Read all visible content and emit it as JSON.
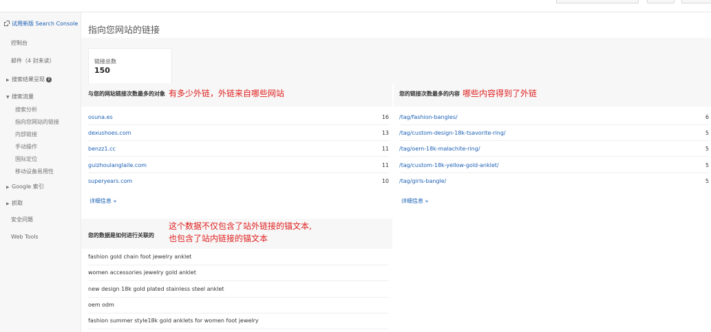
{
  "sidebar": {
    "try_console": "试用新版 Search Console",
    "dashboard": "控制台",
    "messages": "邮件（4 封未读）",
    "search_appearance": "搜索结果呈现",
    "search_traffic": "搜索流量",
    "sub": [
      "搜索分析",
      "指向您网站的链接",
      "内部链接",
      "手动操作",
      "国际定位",
      "移动设备易用性"
    ],
    "google_index": "Google 索引",
    "crawl": "抓取",
    "security": "安全问题",
    "web_tools": "Web Tools"
  },
  "main": {
    "title": "指向您网站的链接",
    "total_label": "链接总数",
    "total_value": "150",
    "left_section": {
      "heading": "与您的网站链接次数最多的对象",
      "annotation": "有多少外链，外链来自哪些网站",
      "rows": [
        {
          "label": "osuna.es",
          "value": "16"
        },
        {
          "label": "dexushoes.com",
          "value": "13"
        },
        {
          "label": "benzz1.cc",
          "value": "11"
        },
        {
          "label": "guizhoulanglaile.com",
          "value": "11"
        },
        {
          "label": "superyears.com",
          "value": "10"
        }
      ],
      "more": "详细信息 »"
    },
    "right_section": {
      "heading": "您的链接次数最多的内容",
      "annotation": "哪些内容得到了外链",
      "rows": [
        {
          "label": "/tag/fashion-bangles/",
          "value": "6"
        },
        {
          "label": "/tag/custom-design-18k-tsavorite-ring/",
          "value": "5"
        },
        {
          "label": "/tag/oem-18k-malachite-ring/",
          "value": "5"
        },
        {
          "label": "/tag/custom-18k-yellow-gold-anklet/",
          "value": "5"
        },
        {
          "label": "/tag/girls-bangle/",
          "value": "5"
        }
      ],
      "more": "详细信息 »"
    },
    "anchor_section": {
      "heading": "您的数据是如何进行关联的",
      "annotation_line1": "这个数据不仅包含了站外链接的锚文本,",
      "annotation_line2": "也包含了站内链接的锚文本",
      "rows": [
        "fashion gold chain foot jewelry anklet",
        "women accessories jewelry gold anklet",
        "new design 18k gold plated stainless steel anklet",
        "oem odm",
        "fashion summer style18k gold anklets for women foot jewelry"
      ]
    }
  },
  "icons": {
    "external": "external-link-icon",
    "info": "info-icon",
    "collapsed": "triangle-right-icon",
    "expanded": "triangle-down-icon"
  },
  "colors": {
    "link": "#1a5fb4",
    "active": "#dd4b39",
    "annotation": "#e02020"
  }
}
